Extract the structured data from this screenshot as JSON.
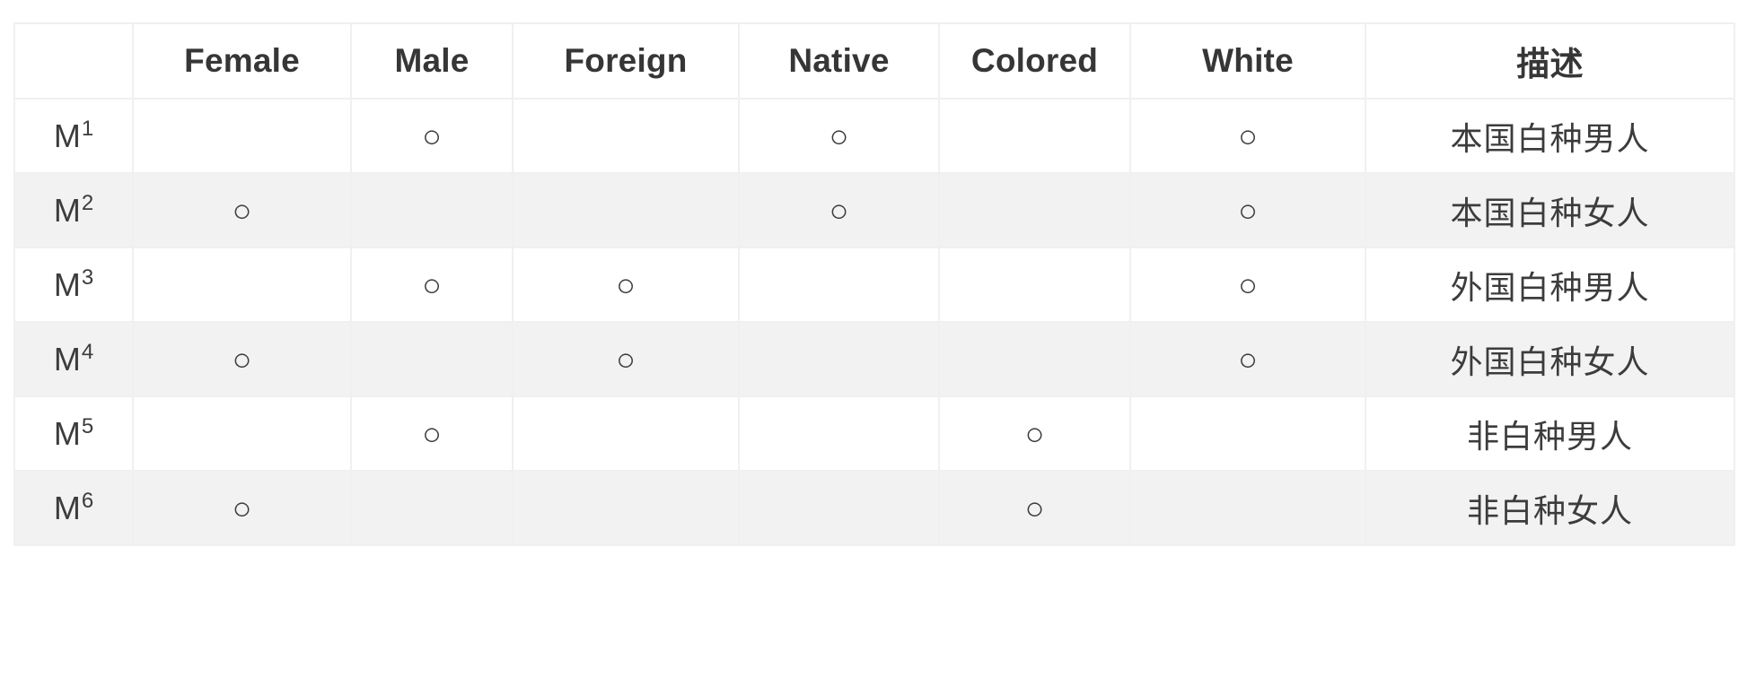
{
  "table": {
    "marker_glyph": "○",
    "columns": [
      {
        "key": "label",
        "label": ""
      },
      {
        "key": "female",
        "label": "Female"
      },
      {
        "key": "male",
        "label": "Male"
      },
      {
        "key": "foreign",
        "label": "Foreign"
      },
      {
        "key": "native",
        "label": "Native"
      },
      {
        "key": "colored",
        "label": "Colored"
      },
      {
        "key": "white",
        "label": "White"
      },
      {
        "key": "desc",
        "label": "描述"
      }
    ],
    "rows": [
      {
        "label_base": "M",
        "label_sup": "1",
        "female": "",
        "male": "○",
        "foreign": "",
        "native": "○",
        "colored": "",
        "white": "○",
        "desc": "本国白种男人"
      },
      {
        "label_base": "M",
        "label_sup": "2",
        "female": "○",
        "male": "",
        "foreign": "",
        "native": "○",
        "colored": "",
        "white": "○",
        "desc": "本国白种女人"
      },
      {
        "label_base": "M",
        "label_sup": "3",
        "female": "",
        "male": "○",
        "foreign": "○",
        "native": "",
        "colored": "",
        "white": "○",
        "desc": "外国白种男人"
      },
      {
        "label_base": "M",
        "label_sup": "4",
        "female": "○",
        "male": "",
        "foreign": "○",
        "native": "",
        "colored": "",
        "white": "○",
        "desc": "外国白种女人"
      },
      {
        "label_base": "M",
        "label_sup": "5",
        "female": "",
        "male": "○",
        "foreign": "",
        "native": "",
        "colored": "○",
        "white": "",
        "desc": "非白种男人"
      },
      {
        "label_base": "M",
        "label_sup": "6",
        "female": "○",
        "male": "",
        "foreign": "",
        "native": "",
        "colored": "○",
        "white": "",
        "desc": "非白种女人"
      }
    ]
  },
  "colors": {
    "border": "#f0f0f0",
    "row_stripe": "#f2f2f2",
    "row_base": "#ffffff",
    "text": "#3c3c3c",
    "header_text": "#363636"
  }
}
